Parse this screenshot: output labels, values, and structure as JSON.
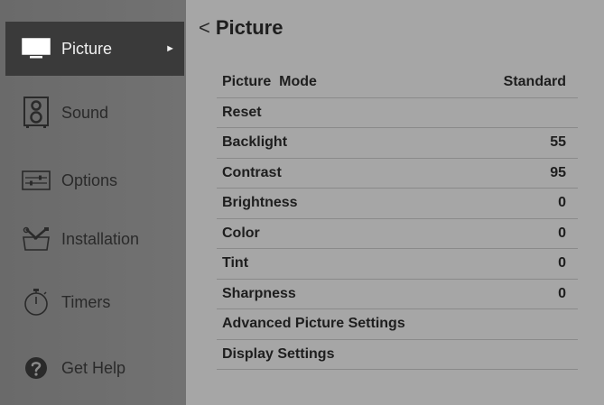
{
  "sidebar": {
    "items": [
      {
        "label": "Picture",
        "icon": "tv-icon",
        "selected": true
      },
      {
        "label": "Sound",
        "icon": "speaker-icon"
      },
      {
        "label": "Options",
        "icon": "options-icon"
      },
      {
        "label": "Installation",
        "icon": "tools-icon"
      },
      {
        "label": "Timers",
        "icon": "timer-icon"
      },
      {
        "label": "Get Help",
        "icon": "help-icon"
      }
    ],
    "selected_arrow": "►"
  },
  "header": {
    "back": "<",
    "title": "Picture"
  },
  "menu": [
    {
      "label": "Picture  Mode",
      "value": "Standard"
    },
    {
      "label": "Reset",
      "value": ""
    },
    {
      "label": "Backlight",
      "value": "55"
    },
    {
      "label": "Contrast",
      "value": "95"
    },
    {
      "label": "Brightness",
      "value": "0"
    },
    {
      "label": "Color",
      "value": "0"
    },
    {
      "label": "Tint",
      "value": "0"
    },
    {
      "label": "Sharpness",
      "value": "0"
    },
    {
      "label": "Advanced Picture Settings",
      "value": ""
    },
    {
      "label": "Display Settings",
      "value": ""
    }
  ]
}
